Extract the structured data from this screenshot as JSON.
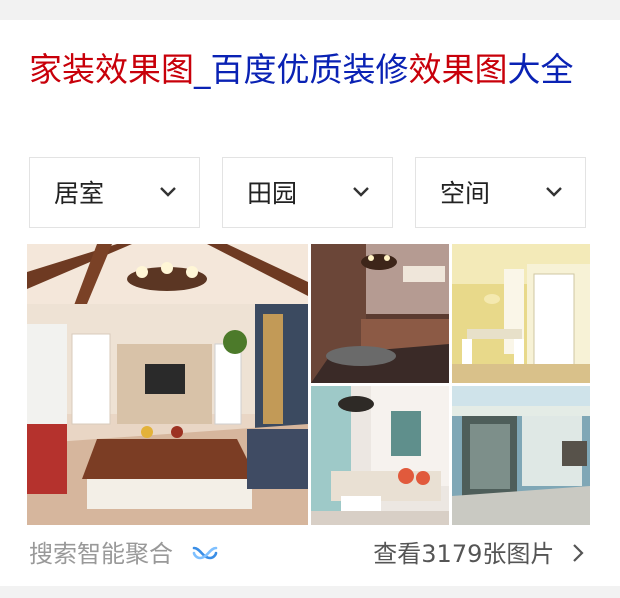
{
  "result": {
    "title_parts": [
      {
        "text": "家装效果图",
        "style": "highlight"
      },
      {
        "text": "_百度优质装修",
        "style": "plain"
      },
      {
        "text": "效果图",
        "style": "highlight"
      },
      {
        "text": "大全",
        "style": "plain"
      }
    ],
    "colors": {
      "highlight": "#c8000a",
      "link": "#0a22b4",
      "page_background": "#f2f2f2"
    }
  },
  "filters": [
    {
      "label": "居室",
      "icon": "chevron-down-icon"
    },
    {
      "label": "田园",
      "icon": "chevron-down-icon"
    },
    {
      "label": "空间",
      "icon": "chevron-down-icon"
    }
  ],
  "gallery": {
    "images": [
      "living-room-photo",
      "bedroom-photo",
      "dining-room-photo",
      "sitting-room-photo",
      "patio-photo"
    ]
  },
  "footer": {
    "source_label": "搜索智能聚合",
    "source_icon": "bowtie-logo-icon",
    "more_link": "查看3179张图片",
    "more_icon": "chevron-right-icon"
  }
}
